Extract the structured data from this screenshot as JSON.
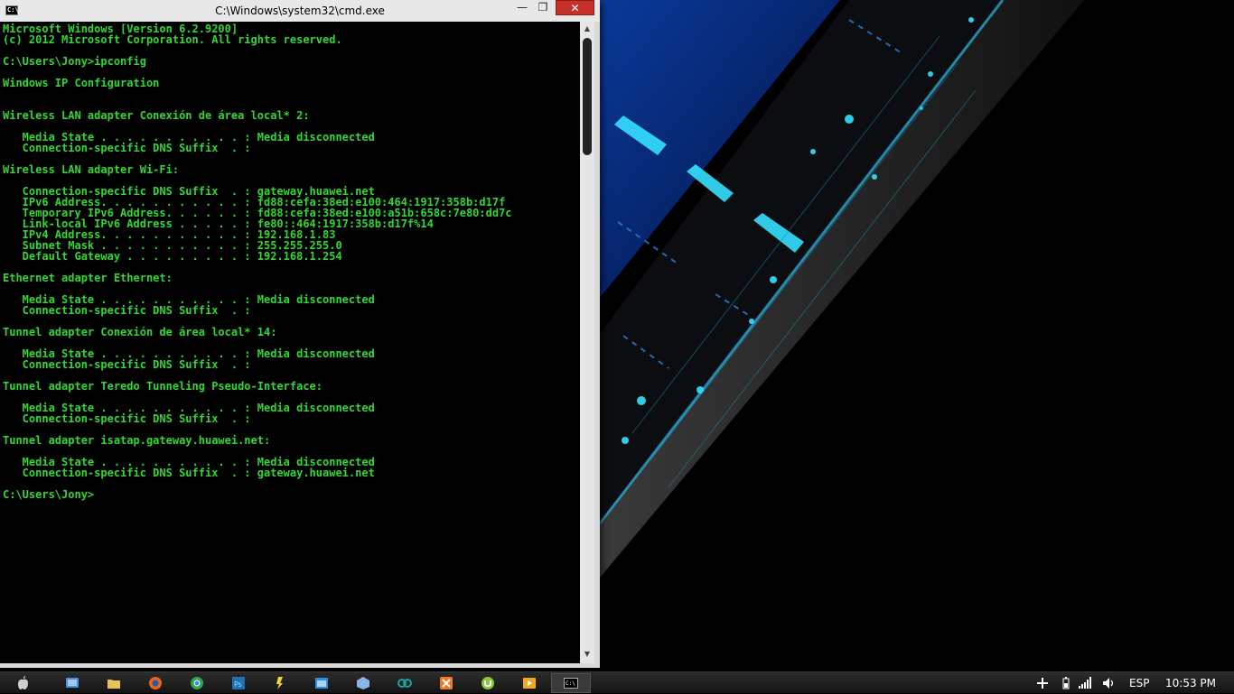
{
  "window": {
    "title": "C:\\Windows\\system32\\cmd.exe",
    "icon_label": "C:\\",
    "buttons": {
      "minimize": "—",
      "maximize": "❐",
      "close": "✕"
    }
  },
  "console": {
    "text_color": "#33d633",
    "lines": [
      "Microsoft Windows [Version 6.2.9200]",
      "(c) 2012 Microsoft Corporation. All rights reserved.",
      "",
      "C:\\Users\\Jony>ipconfig",
      "",
      "Windows IP Configuration",
      "",
      "",
      "Wireless LAN adapter Conexión de área local* 2:",
      "",
      "   Media State . . . . . . . . . . . : Media disconnected",
      "   Connection-specific DNS Suffix  . :",
      "",
      "Wireless LAN adapter Wi-Fi:",
      "",
      "   Connection-specific DNS Suffix  . : gateway.huawei.net",
      "   IPv6 Address. . . . . . . . . . . : fd88:cefa:38ed:e100:464:1917:358b:d17f",
      "   Temporary IPv6 Address. . . . . . : fd88:cefa:38ed:e100:a51b:658c:7e80:dd7c",
      "   Link-local IPv6 Address . . . . . : fe80::464:1917:358b:d17f%14",
      "   IPv4 Address. . . . . . . . . . . : 192.168.1.83",
      "   Subnet Mask . . . . . . . . . . . : 255.255.255.0",
      "   Default Gateway . . . . . . . . . : 192.168.1.254",
      "",
      "Ethernet adapter Ethernet:",
      "",
      "   Media State . . . . . . . . . . . : Media disconnected",
      "   Connection-specific DNS Suffix  . :",
      "",
      "Tunnel adapter Conexión de área local* 14:",
      "",
      "   Media State . . . . . . . . . . . : Media disconnected",
      "   Connection-specific DNS Suffix  . :",
      "",
      "Tunnel adapter Teredo Tunneling Pseudo-Interface:",
      "",
      "   Media State . . . . . . . . . . . : Media disconnected",
      "   Connection-specific DNS Suffix  . :",
      "",
      "Tunnel adapter isatap.gateway.huawei.net:",
      "",
      "   Media State . . . . . . . . . . . : Media disconnected",
      "   Connection-specific DNS Suffix  . : gateway.huawei.net",
      "",
      "C:\\Users\\Jony>"
    ]
  },
  "taskbar": {
    "apps": [
      {
        "name": "apple-icon",
        "color": "#cfcfcf"
      },
      {
        "name": "control-panel-icon",
        "color": "#4a8fd6"
      },
      {
        "name": "file-explorer-icon",
        "color": "#e8c25a"
      },
      {
        "name": "firefox-icon",
        "color": "#e8641b"
      },
      {
        "name": "chrome-icon",
        "color": "#2ea44f"
      },
      {
        "name": "photoshop-icon",
        "color": "#1f6fb5"
      },
      {
        "name": "usb-tool-icon",
        "color": "#f2d43b"
      },
      {
        "name": "window-app-icon",
        "color": "#2b8fe0"
      },
      {
        "name": "virtualbox-icon",
        "color": "#8ab6e8"
      },
      {
        "name": "arduino-icon",
        "color": "#1aa2a8"
      },
      {
        "name": "xampp-icon",
        "color": "#f07a23"
      },
      {
        "name": "utorrent-icon",
        "color": "#8cc63f"
      },
      {
        "name": "media-player-icon",
        "color": "#f5a623"
      },
      {
        "name": "cmd-icon",
        "color": "#000000"
      }
    ],
    "tray": {
      "language": "ESP",
      "time": "10:53 PM"
    }
  },
  "wallpaper": {
    "accent": "#00b4ff",
    "glow": "#34e0ff"
  }
}
